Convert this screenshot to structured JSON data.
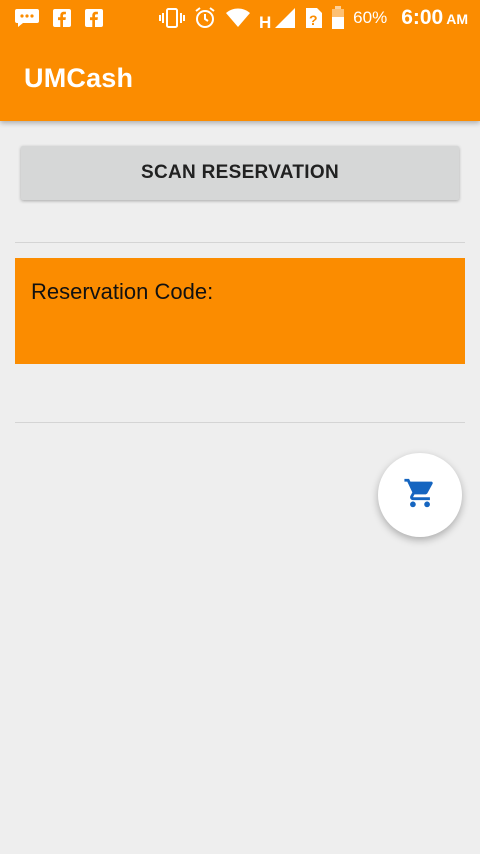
{
  "status_bar": {
    "icons": [
      "message-icon",
      "facebook-icon",
      "facebook-icon",
      "vibrate-icon",
      "alarm-icon",
      "wifi-icon",
      "signal-h-icon",
      "sim-unknown-icon",
      "battery-icon"
    ],
    "battery_percent": "60%",
    "time": "6:00",
    "ampm": "AM"
  },
  "app_bar": {
    "title": "UMCash",
    "color": "#fb8c00"
  },
  "main": {
    "scan_button_label": "SCAN RESERVATION",
    "reservation_label": "Reservation Code:",
    "reservation_value": ""
  },
  "fab": {
    "icon": "shopping-cart-icon",
    "icon_color": "#1565c0"
  }
}
